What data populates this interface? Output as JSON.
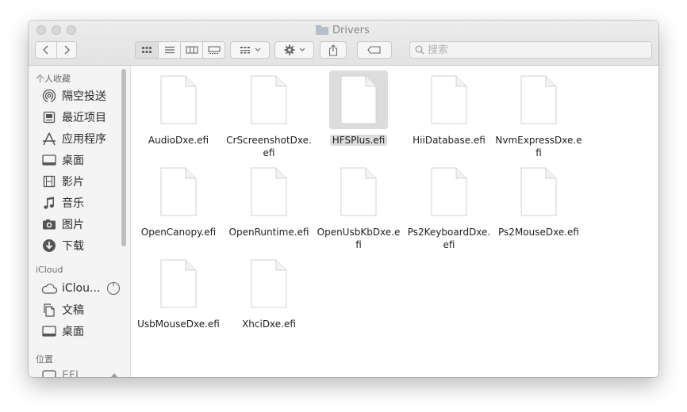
{
  "window": {
    "title": "Drivers"
  },
  "toolbar": {
    "search_placeholder": "搜索"
  },
  "sidebar": {
    "favorites_header": "个人收藏",
    "favorites": [
      {
        "label": "隔空投送",
        "icon": "airdrop-icon"
      },
      {
        "label": "最近项目",
        "icon": "recents-icon"
      },
      {
        "label": "应用程序",
        "icon": "applications-icon"
      },
      {
        "label": "桌面",
        "icon": "desktop-icon"
      },
      {
        "label": "影片",
        "icon": "movies-icon"
      },
      {
        "label": "音乐",
        "icon": "music-icon"
      },
      {
        "label": "图片",
        "icon": "pictures-icon"
      },
      {
        "label": "下载",
        "icon": "downloads-icon"
      }
    ],
    "icloud_header": "iCloud",
    "icloud": [
      {
        "label": "iClou...",
        "icon": "cloud-icon"
      },
      {
        "label": "文稿",
        "icon": "documents-icon"
      },
      {
        "label": "桌面",
        "icon": "desktop-icon"
      }
    ],
    "locations_header": "位置",
    "locations": [
      {
        "label": "EFI",
        "icon": "disk-icon"
      }
    ]
  },
  "files": [
    {
      "name": "AudioDxe.efi",
      "lines": [
        "AudioDxe.efi"
      ]
    },
    {
      "name": "CrScreenshotDxe.efi",
      "lines": [
        "CrScreenshotDxe.",
        "efi"
      ]
    },
    {
      "name": "HFSPlus.efi",
      "lines": [
        "HFSPlus.efi"
      ],
      "selected": true
    },
    {
      "name": "HiiDatabase.efi",
      "lines": [
        "HiiDatabase.efi"
      ]
    },
    {
      "name": "NvmExpressDxe.efi",
      "lines": [
        "NvmExpressDxe.e",
        "fi"
      ]
    },
    {
      "name": "OpenCanopy.efi",
      "lines": [
        "OpenCanopy.efi"
      ]
    },
    {
      "name": "OpenRuntime.efi",
      "lines": [
        "OpenRuntime.efi"
      ]
    },
    {
      "name": "OpenUsbKbDxe.efi",
      "lines": [
        "OpenUsbKbDxe.e",
        "fi"
      ]
    },
    {
      "name": "Ps2KeyboardDxe.efi",
      "lines": [
        "Ps2KeyboardDxe.",
        "efi"
      ]
    },
    {
      "name": "Ps2MouseDxe.efi",
      "lines": [
        "Ps2MouseDxe.efi"
      ]
    },
    {
      "name": "UsbMouseDxe.efi",
      "lines": [
        "UsbMouseDxe.efi"
      ]
    },
    {
      "name": "XhciDxe.efi",
      "lines": [
        "XhciDxe.efi"
      ]
    }
  ],
  "colors": {
    "selection": "#dcdcdc",
    "sidebar_bg": "#f4f4f4"
  }
}
